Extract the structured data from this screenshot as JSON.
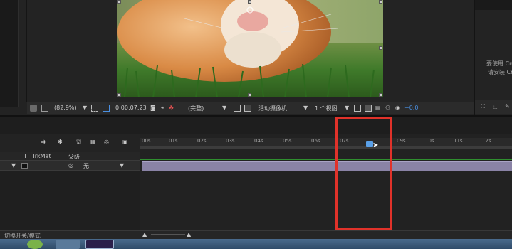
{
  "viewer": {
    "zoom": "(82.9%)",
    "timecode": "0:00:07:23",
    "resolution": "(完整)",
    "camera": "活动摄像机",
    "view_layout": "1 个视图",
    "exposure": "+0.0"
  },
  "right_panel": {
    "line1": "要使用 Cre",
    "line2": "请安装 Cre"
  },
  "timeline": {
    "column_trkmat": "TrkMat",
    "column_t": "T",
    "column_parent": "父级",
    "parent_value": "无",
    "ruler_ticks": [
      "00s",
      "01s",
      "02s",
      "03s",
      "04s",
      "05s",
      "06s",
      "07s",
      "09s",
      "10s",
      "11s",
      "12s"
    ],
    "playhead_time_fraction": 0.8
  },
  "status": {
    "label": "切换开关/模式"
  },
  "colors": {
    "playhead": "#d23a2a",
    "highlight": "#e0322a",
    "layer_bar": "#8a83a6",
    "accent_blue": "#5aa0e8"
  }
}
